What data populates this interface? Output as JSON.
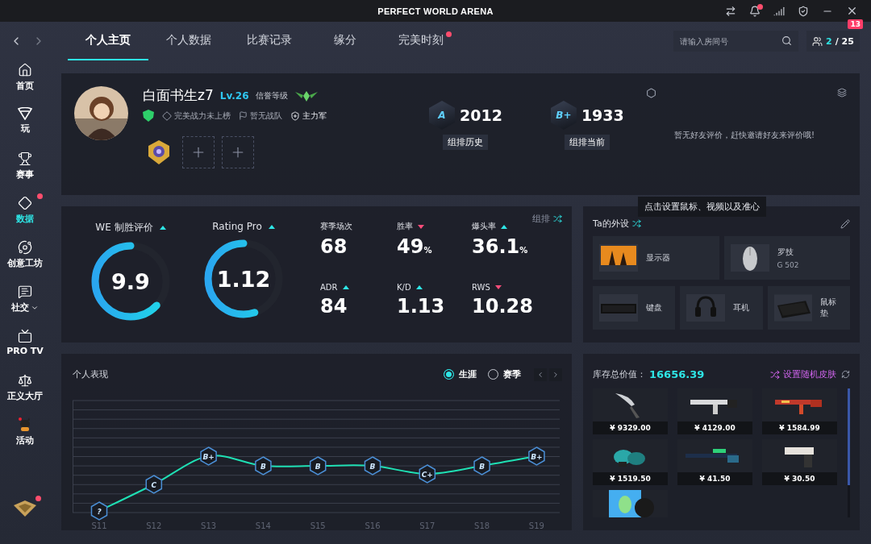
{
  "window": {
    "title": "PERFECT WORLD ARENA",
    "bell_unread": true
  },
  "nav": {
    "tabs": [
      {
        "label": "个人主页",
        "selected": true,
        "dot": false
      },
      {
        "label": "个人数据",
        "selected": false,
        "dot": false
      },
      {
        "label": "比赛记录",
        "selected": false,
        "dot": false
      },
      {
        "label": "缘分",
        "selected": false,
        "dot": false
      },
      {
        "label": "完美时刻",
        "selected": false,
        "dot": true
      }
    ],
    "search": {
      "placeholder": "请输入房间号"
    },
    "friends": {
      "online": "2",
      "total": "/ 25",
      "badge": "13"
    }
  },
  "sidebar": {
    "items": [
      {
        "label": "首页",
        "kind": "home",
        "selected": false,
        "dot": false
      },
      {
        "label": "玩",
        "kind": "play",
        "selected": false,
        "dot": false
      },
      {
        "label": "赛事",
        "kind": "trophy",
        "selected": false,
        "dot": false
      },
      {
        "label": "数据",
        "kind": "data",
        "selected": true,
        "dot": true
      },
      {
        "label": "创意工坊",
        "kind": "planet",
        "selected": false,
        "dot": false
      },
      {
        "label": "社交",
        "kind": "chat",
        "selected": false,
        "dot": false,
        "expandable": true
      },
      {
        "label": "PRO TV",
        "kind": "tv",
        "selected": false,
        "dot": false
      },
      {
        "label": "正义大厅",
        "kind": "scale",
        "selected": false,
        "dot": false
      },
      {
        "label": "活动",
        "kind": "mascot",
        "selected": false,
        "dot": false
      }
    ],
    "vip_dot": true
  },
  "profile": {
    "name": "白面书生z7",
    "level": "Lv.26",
    "credit_label": "信誉等级",
    "tags": [
      {
        "text": "完美战力未上榜",
        "kind": "power"
      },
      {
        "text": "暂无战队",
        "kind": "team"
      },
      {
        "text": "主力军",
        "kind": "army",
        "active": true
      }
    ],
    "slots": [
      {
        "kind": "medal"
      },
      {
        "kind": "empty"
      },
      {
        "kind": "empty"
      }
    ],
    "ranks": [
      {
        "grade": "A",
        "score": "2012",
        "label": "组排历史"
      },
      {
        "grade": "B+",
        "score": "1933",
        "label": "组排当前"
      }
    ],
    "friend_review": "暂无好友评价，赶快邀请好友来评价哦!"
  },
  "tooltip": "点击设置鼠标、视频以及准心",
  "stats": {
    "mode": "组排",
    "gauges": [
      {
        "label": "WE 制胜评价",
        "value": "9.9",
        "rising": true,
        "level": 0.63
      },
      {
        "label": "Rating Pro",
        "value": "1.12",
        "rising": true,
        "level": 0.55
      }
    ],
    "metrics": [
      {
        "label": "赛季场次",
        "value": "68"
      },
      {
        "label": "胜率",
        "value": "49",
        "unit": "%",
        "rising": false
      },
      {
        "label": "爆头率",
        "value": "36.1",
        "unit": "%",
        "rising": true
      },
      {
        "label": "ADR",
        "value": "84",
        "rising": true
      },
      {
        "label": "K/D",
        "value": "1.13",
        "rising": true
      },
      {
        "label": "RWS",
        "value": "10.28",
        "rising": false
      }
    ]
  },
  "peripherals": {
    "title": "Ta的外设",
    "items": [
      {
        "name": "显示器",
        "kind": "monitor"
      },
      {
        "name": "罗技",
        "model": "G 502",
        "kind": "mouse"
      },
      {
        "name": "键盘",
        "kind": "keyboard"
      },
      {
        "name": "耳机",
        "kind": "headset"
      },
      {
        "name": "鼠标垫",
        "kind": "mousepad"
      }
    ]
  },
  "performance": {
    "title": "个人表现",
    "options": [
      {
        "label": "生涯",
        "selected": true
      },
      {
        "label": "赛季",
        "selected": false
      }
    ],
    "seasons": [
      {
        "label": "S11",
        "rank": "?",
        "kind": "unranked"
      },
      {
        "label": "S12",
        "rank": "C",
        "kind": "c"
      },
      {
        "label": "S13",
        "rank": "B+",
        "kind": "b_plus"
      },
      {
        "label": "S14",
        "rank": "B",
        "kind": "b"
      },
      {
        "label": "S15",
        "rank": "B",
        "kind": "b"
      },
      {
        "label": "S16",
        "rank": "B",
        "kind": "b"
      },
      {
        "label": "S17",
        "rank": "C+",
        "kind": "c_plus"
      },
      {
        "label": "S18",
        "rank": "B",
        "kind": "b"
      },
      {
        "label": "S19",
        "rank": "B+",
        "kind": "b_plus"
      }
    ]
  },
  "inventory": {
    "label": "库存总价值：",
    "total": "16656.39",
    "random_skin": "设置随机皮肤",
    "items": [
      {
        "price": "¥ 9329.00",
        "kind": "knife"
      },
      {
        "price": "¥ 4129.00",
        "kind": "rifle"
      },
      {
        "price": "¥ 1584.99",
        "kind": "rifle_red"
      },
      {
        "price": "¥ 1519.50",
        "kind": "gloves"
      },
      {
        "price": "¥ 41.50",
        "kind": "sniper"
      },
      {
        "price": "¥ 30.50",
        "kind": "pistol"
      },
      {
        "kind": "sticker"
      }
    ]
  }
}
